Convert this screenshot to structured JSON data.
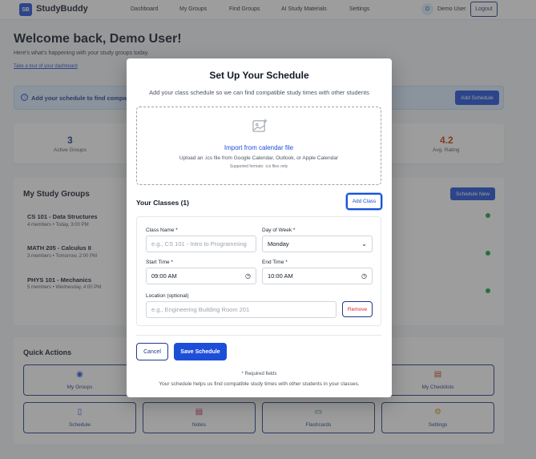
{
  "nav": {
    "logo_badge": "SB",
    "app_name": "StudyBuddy",
    "links": [
      "Dashboard",
      "My Groups",
      "Find Groups",
      "AI Study Materials",
      "Settings"
    ],
    "avatar_initial": "D",
    "user_name": "Demo User",
    "logout_label": "Logout"
  },
  "dashboard": {
    "welcome": "Welcome back, Demo User!",
    "subtitle": "Here's what's happening with your study groups today.",
    "tour_link": "Take a tour of your dashboard",
    "banner_icon": "ⓘ",
    "banner_text": "Add your schedule to find compatible",
    "banner_button": "Add Schedule",
    "stats": [
      {
        "value": "3",
        "label": "Active Groups",
        "color": "#1e3a8a"
      },
      {
        "value": "4.2",
        "label": "Avg. Rating",
        "color": "#c2410c"
      }
    ],
    "groups_title": "My Study Groups",
    "schedule_new": "Schedule New",
    "groups": [
      {
        "name": "CS 101 - Data Structures",
        "meta": "4 members • Today, 3:00 PM"
      },
      {
        "name": "MATH 205 - Calculus II",
        "meta": "3 members • Tomorrow, 2:00 PM"
      },
      {
        "name": "PHYS 101 - Mechanics",
        "meta": "5 members • Wednesday, 4:00 PM"
      }
    ],
    "quick_actions_title": "Quick Actions",
    "quick_actions": [
      {
        "label": "My Groups",
        "icon": "users-icon"
      },
      {
        "label": "My Checklists",
        "icon": "clipboard-icon"
      },
      {
        "label": "Schedule",
        "icon": "calendar-icon"
      },
      {
        "label": "Notes",
        "icon": "document-icon"
      },
      {
        "label": "Flashcards",
        "icon": "stack-icon"
      },
      {
        "label": "Settings",
        "icon": "gear-icon"
      }
    ]
  },
  "modal": {
    "title": "Set Up Your Schedule",
    "subtitle": "Add your class schedule so we can find compatible study times with other students",
    "import_link": "Import from calendar file",
    "import_text": "Upload an .ics file from Google Calendar, Outlook, or Apple Calendar",
    "import_formats": "Supported formats: .ics files only",
    "classes_header": "Your Classes (1)",
    "add_class": "Add Class",
    "class_name_label": "Class Name *",
    "class_name_placeholder": "e.g., CS 101 - Intro to Programming",
    "day_label": "Day of Week *",
    "day_value": "Monday",
    "start_label": "Start Time *",
    "start_value": "09:00 AM",
    "end_label": "End Time *",
    "end_value": "10:00 AM",
    "location_label": "Location (optional)",
    "location_placeholder": "e.g., Engineering Building Room 201",
    "remove": "Remove",
    "cancel": "Cancel",
    "save": "Save Schedule",
    "required_note": "* Required fields",
    "footer": "Your schedule helps us find compatible study times with other students in your classes."
  }
}
